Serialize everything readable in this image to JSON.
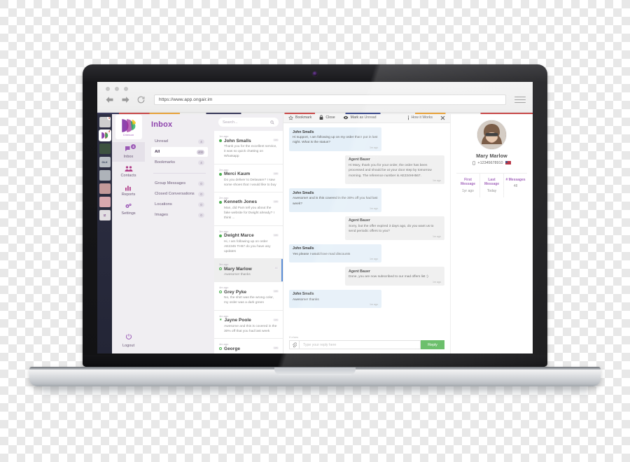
{
  "browser": {
    "url": "https://www.app.ongair.im",
    "back_icon": "back-arrow-icon",
    "forward_icon": "forward-arrow-icon",
    "reload_icon": "reload-icon",
    "menu_icon": "hamburger-menu-icon"
  },
  "rail": {
    "tiles": [
      {
        "name": "olx-red-app",
        "label": "",
        "badge": "1"
      },
      {
        "name": "crimson-app",
        "label": "Crimson",
        "badge": "4"
      },
      {
        "name": "green-app",
        "label": "",
        "badge": ""
      },
      {
        "name": "olx-app",
        "label": "OLX",
        "badge": ""
      },
      {
        "name": "music-app",
        "label": "",
        "badge": ""
      },
      {
        "name": "red-tile-app",
        "label": "",
        "badge": ""
      },
      {
        "name": "pink-app",
        "label": "",
        "badge": ""
      },
      {
        "name": "check-app",
        "label": "",
        "badge": ""
      }
    ]
  },
  "nav": {
    "brand": "Crimson",
    "items": [
      {
        "label": "Inbox",
        "icon": "chat-bubble-icon",
        "badge": "4",
        "active": true
      },
      {
        "label": "Contacts",
        "icon": "people-icon",
        "badge": "",
        "active": false
      },
      {
        "label": "Reports",
        "icon": "bar-chart-icon",
        "badge": "",
        "active": false
      },
      {
        "label": "Settings",
        "icon": "gears-icon",
        "badge": "",
        "active": false
      }
    ],
    "logout": {
      "label": "Logout",
      "icon": "power-icon"
    }
  },
  "folders": {
    "title": "Inbox",
    "primary": [
      {
        "label": "Unread",
        "count": "4",
        "active": false
      },
      {
        "label": "All",
        "count": "400",
        "active": true
      },
      {
        "label": "Bookmarks",
        "count": "4",
        "active": false
      }
    ],
    "secondary": [
      {
        "label": "Group Messages",
        "count": "0"
      },
      {
        "label": "Closed Conversations",
        "count": "0"
      },
      {
        "label": "Locations",
        "count": "0"
      },
      {
        "label": "Images",
        "count": "0"
      }
    ]
  },
  "search": {
    "placeholder": "Search...",
    "icon": "search-icon"
  },
  "conversations": [
    {
      "time": "1m ago",
      "name": "John Smalls",
      "snippet": "Thank you for the excellent service, it was so quick chatting on Whatsapp",
      "dot": "filled",
      "tag": "wa",
      "selected": false
    },
    {
      "time": "2m ago",
      "name": "Merci Kaum",
      "snippet": "Do you deliver to Delaware? I saw some shoes that I would like to buy",
      "dot": "filled",
      "tag": "wa",
      "selected": false
    },
    {
      "time": "2m ago",
      "name": "Kenneth Jones",
      "snippet": "Man, did Pam tell you about the fake website for Dwight already? I think ...",
      "dot": "filled",
      "tag": "wa",
      "selected": false
    },
    {
      "time": "3m ago",
      "name": "Dwight Marce",
      "snippet": "Hi, I am following up on order AE2345 TH67 do you have any updates",
      "dot": "filled",
      "tag": "wa",
      "selected": false
    },
    {
      "time": "3m ago",
      "name": "Mary Marlow",
      "snippet": "Awesome! thanks",
      "dot": "hollow",
      "tag": "48",
      "selected": true
    },
    {
      "time": "4m ago",
      "name": "Grey Pyke",
      "snippet": "No, the shirt was the wrong color, my order was a dark green",
      "dot": "hollow",
      "tag": "wa",
      "selected": false
    },
    {
      "time": "4m ago",
      "name": "Jayne Poole",
      "snippet": "Awesome and this is covered in the 30% off that you had last week",
      "dot": "star",
      "tag": "wa",
      "selected": false
    },
    {
      "time": "4m ago",
      "name": "George",
      "snippet": "",
      "dot": "hollow",
      "tag": "wa",
      "selected": false
    }
  ],
  "toolbar": {
    "bookmark": "Bookmark",
    "bookmark_icon": "star-icon",
    "close": "Close",
    "close_icon": "lock-icon",
    "mark_unread": "Mark as Unread",
    "mark_unread_icon": "eye-icon",
    "how_it_works": "How it Works",
    "how_it_works_icon": "info-icon",
    "dismiss_icon": "close-x-icon"
  },
  "messages": [
    {
      "dir": "in",
      "name": "John Smalls",
      "text": "Hi support, I am following up on my order that I put in last night. What is the status?",
      "time": "1m ago"
    },
    {
      "dir": "out",
      "name": "Agent Bauer",
      "text": "Hi Mary, thank you for your order, the order has been processed and should be at your door step by tomorrow morning. The reference number is AE234HH567.",
      "time": "1m ago"
    },
    {
      "dir": "in",
      "name": "John Smalls",
      "text": "Awesome! and is this covered in the 30% off you had last week?",
      "time": "1m ago"
    },
    {
      "dir": "out",
      "name": "Agent Bauer",
      "text": "Sorry, but the offer expired 3 days ago, do you want us to send periodic offers to you?",
      "time": "1m ago"
    },
    {
      "dir": "in",
      "name": "John Smalls",
      "text": "Yes please I would love mad discounts",
      "time": "1m ago"
    },
    {
      "dir": "out",
      "name": "Agent Bauer",
      "text": "Done, you are now subscribed to our mad offers list :)",
      "time": "1m ago"
    },
    {
      "dir": "in",
      "name": "John Smalls",
      "text": "Awesome! thanks",
      "time": "1m ago"
    }
  ],
  "composer": {
    "chars": "0 chars",
    "placeholder": "Type your reply here",
    "reply_label": "Reply",
    "attach_icon": "paperclip-icon"
  },
  "contact": {
    "avatar_icon": "user-avatar-photo",
    "name": "Mary Marlow",
    "phone": "+12345678910",
    "phone_icon": "mobile-phone-icon",
    "flag_icon": "us-flag-icon",
    "stats": [
      {
        "label": "First Message",
        "value": "1yr ago"
      },
      {
        "label": "Last Message",
        "value": "Today"
      },
      {
        "label": "# Messages",
        "value": "48"
      }
    ]
  },
  "colors": {
    "accent_purple": "#8e44ad",
    "reply_green": "#5cb85c",
    "online_green": "#4caf50",
    "incoming_bubble": "#e4eff8",
    "outgoing_bubble": "#eeeeee"
  }
}
